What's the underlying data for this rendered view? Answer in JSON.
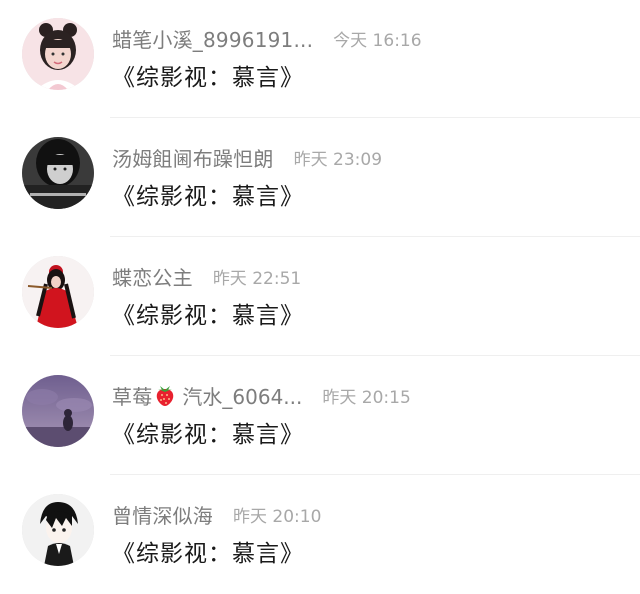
{
  "conversations": [
    {
      "name": "蜡笔小溪_8996191...",
      "time": "今天 16:16",
      "message": "《综影视：慕言》",
      "avatar_icon": "girl-portrait-avatar"
    },
    {
      "name": "汤姆飷阃布躁怛朗",
      "time": "昨天 23:09",
      "message": "《综影视：慕言》",
      "avatar_icon": "dark-girl-avatar"
    },
    {
      "name": "蝶恋公主",
      "time": "昨天 22:51",
      "message": "《综影视：慕言》",
      "avatar_icon": "red-costume-avatar"
    },
    {
      "name_part1": "草莓",
      "emoji_icon": "strawberry-icon",
      "name_part2": "汽水_6064...",
      "time": "昨天 20:15",
      "message": "《综影视：慕言》",
      "avatar_icon": "purple-sky-avatar"
    },
    {
      "name": "曾情深似海",
      "time": "昨天 20:10",
      "message": "《综影视：慕言》",
      "avatar_icon": "anime-boy-avatar"
    }
  ],
  "colors": {
    "name": "#7d7d7d",
    "time": "#a8a8a8",
    "message": "#1a1a1a",
    "divider": "#efefef"
  }
}
